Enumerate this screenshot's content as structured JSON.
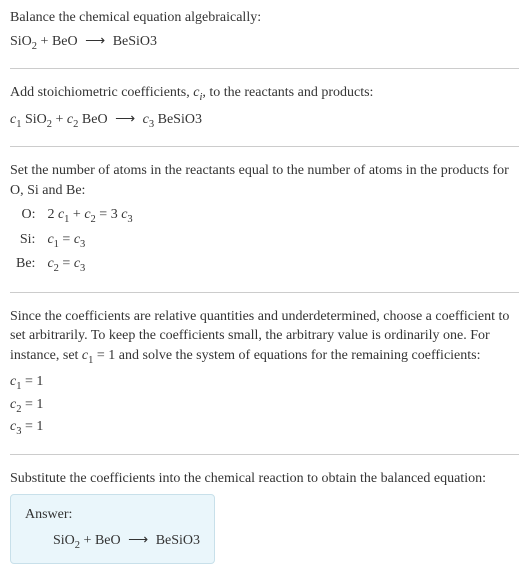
{
  "section1": {
    "intro": "Balance the chemical equation algebraically:",
    "eq": {
      "r1": "SiO",
      "r1sub": "2",
      "plus1": " + ",
      "r2": "BeO",
      "arrow": "⟶",
      "p1": "BeSiO3"
    }
  },
  "section2": {
    "intro_a": "Add stoichiometric coefficients, ",
    "ci_c": "c",
    "ci_i": "i",
    "intro_b": ", to the reactants and products:",
    "eq": {
      "c1c": "c",
      "c1i": "1",
      "r1": " SiO",
      "r1sub": "2",
      "plus1": " + ",
      "c2c": "c",
      "c2i": "2",
      "r2": " BeO",
      "arrow": "⟶",
      "c3c": "c",
      "c3i": "3",
      "p1": " BeSiO3"
    }
  },
  "section3": {
    "intro": "Set the number of atoms in the reactants equal to the number of atoms in the products for O, Si and Be:",
    "rows": [
      {
        "label": "O:",
        "a": "2 ",
        "ac": "c",
        "ai": "1",
        "plus": " + ",
        "bc": "c",
        "bi": "2",
        "eq": " = 3 ",
        "cc": "c",
        "ci": "3"
      },
      {
        "label": "Si:",
        "ac": "c",
        "ai": "1",
        "eq": " = ",
        "cc": "c",
        "ci": "3"
      },
      {
        "label": "Be:",
        "ac": "c",
        "ai": "2",
        "eq": " = ",
        "cc": "c",
        "ci": "3"
      }
    ]
  },
  "section4": {
    "intro_a": "Since the coefficients are relative quantities and underdetermined, choose a coefficient to set arbitrarily. To keep the coefficients small, the arbitrary value is ordinarily one. For instance, set ",
    "cc": "c",
    "ci": "1",
    "intro_b": " = 1 and solve the system of equations for the remaining coefficients:",
    "lines": [
      {
        "cc": "c",
        "ci": "1",
        "val": " = 1"
      },
      {
        "cc": "c",
        "ci": "2",
        "val": " = 1"
      },
      {
        "cc": "c",
        "ci": "3",
        "val": " = 1"
      }
    ]
  },
  "section5": {
    "intro": "Substitute the coefficients into the chemical reaction to obtain the balanced equation:",
    "answer_label": "Answer:",
    "eq": {
      "r1": "SiO",
      "r1sub": "2",
      "plus1": " + ",
      "r2": "BeO",
      "arrow": "⟶",
      "p1": "BeSiO3"
    }
  }
}
